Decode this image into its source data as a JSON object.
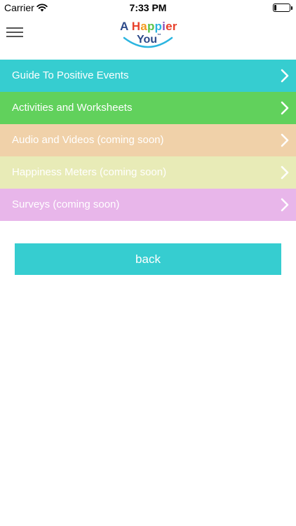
{
  "status_bar": {
    "carrier": "Carrier",
    "time": "7:33 PM",
    "battery_level": 0.15,
    "icons": [
      "wifi-icon",
      "battery-icon"
    ]
  },
  "header": {
    "menu_icon": "hamburger-menu-icon",
    "logo": {
      "line1_word1": "A",
      "line1_word2": "Happier",
      "line2": "You",
      "trademark": "™",
      "letter_colors": [
        "#2d4a8a",
        "#e8412c",
        "#f39a1e",
        "#5cc34a",
        "#2cb5e0",
        "#8a4fb8",
        "#e8412c"
      ]
    }
  },
  "menu": {
    "items": [
      {
        "label": "Guide To Positive Events",
        "color": "#36cdd0"
      },
      {
        "label": "Activities and Worksheets",
        "color": "#61d15c"
      },
      {
        "label": "Audio and Videos (coming soon)",
        "color": "#f0d1a9"
      },
      {
        "label": "Happiness Meters (coming soon)",
        "color": "#e8ebb7"
      },
      {
        "label": "Surveys (coming soon)",
        "color": "#e8b6ea"
      }
    ],
    "chevron_icon": "chevron-right-icon"
  },
  "back_button": {
    "label": "back",
    "color": "#36cdd0"
  }
}
